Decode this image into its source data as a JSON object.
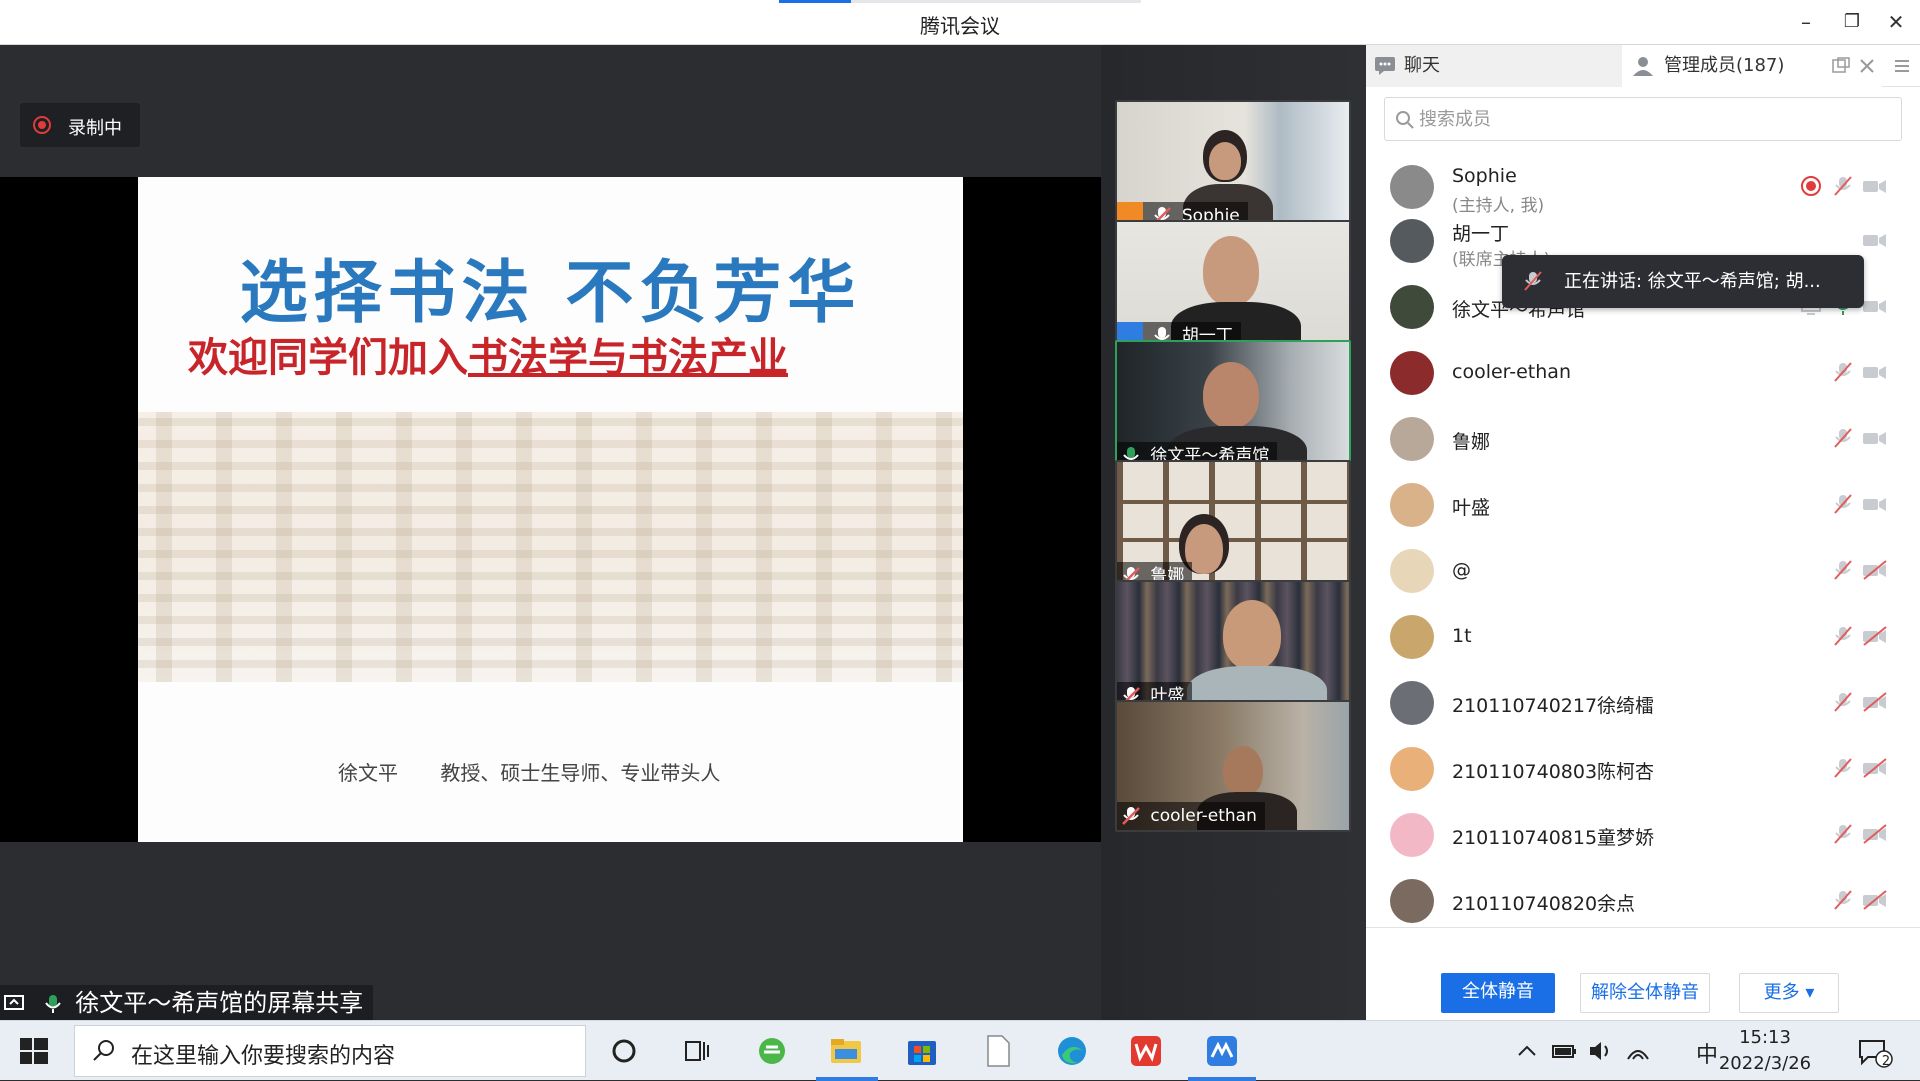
{
  "window": {
    "title": "腾讯会议",
    "minimize_label": "–",
    "restore_label": "❐",
    "close_label": "✕"
  },
  "recording": {
    "label": "录制中"
  },
  "slide": {
    "title": "选择书法  不负芳华",
    "subtitle_prefix": "欢迎同学们加入",
    "subtitle_underlined": "书法学与书法产业",
    "author": "徐文平",
    "author_titles": "教授、硕士生导师、专业带头人"
  },
  "share_label": "徐文平～希声馆的屏幕共享",
  "video_tiles": [
    {
      "name": "Sophie",
      "role": "host",
      "mic": "muted"
    },
    {
      "name": "胡一丁",
      "role": "cohost",
      "mic": "on"
    },
    {
      "name": "徐文平～希声馆",
      "role": "",
      "mic": "speaking",
      "active": true
    },
    {
      "name": "鲁娜",
      "role": "",
      "mic": "muted"
    },
    {
      "name": "叶盛",
      "role": "",
      "mic": "muted"
    },
    {
      "name": "cooler-ethan",
      "role": "",
      "mic": "muted"
    }
  ],
  "panel": {
    "tab_chat": "聊天",
    "tab_members": "管理成员(187)",
    "search_placeholder": "搜索成员",
    "speaking_tooltip": "正在讲话: 徐文平～希声馆; 胡...",
    "members": [
      {
        "name": "Sophie",
        "role": "(主持人, 我)",
        "recording": true,
        "mic": "muted",
        "video": "off",
        "avatar_color": "#8a8a8a"
      },
      {
        "name": "胡一丁",
        "role": "(联席主持人)",
        "mic": "on",
        "video": "off",
        "avatar_color": "#555a5f"
      },
      {
        "name": "徐文平～希声馆",
        "role": "",
        "screen_share": true,
        "mic": "speaking",
        "video": "off",
        "avatar_color": "#3f4a3a"
      },
      {
        "name": "cooler-ethan",
        "role": "",
        "mic": "muted",
        "video": "off",
        "avatar_color": "#8b2b2b"
      },
      {
        "name": "鲁娜",
        "role": "",
        "mic": "muted",
        "video": "off",
        "avatar_color": "#b8a89a"
      },
      {
        "name": "叶盛",
        "role": "",
        "mic": "muted",
        "video": "off",
        "avatar_color": "#d9b28a"
      },
      {
        "name": "@",
        "role": "",
        "mic": "muted",
        "video": "muted",
        "avatar_color": "#e8d6b8"
      },
      {
        "name": "1t",
        "role": "",
        "mic": "muted",
        "video": "muted",
        "avatar_color": "#c9a66b"
      },
      {
        "name": "210110740217徐绮檑",
        "role": "",
        "mic": "muted",
        "video": "muted",
        "avatar_color": "#6b6f75"
      },
      {
        "name": "210110740803陈柯杏",
        "role": "",
        "mic": "muted",
        "video": "muted",
        "avatar_color": "#e9b07a"
      },
      {
        "name": "210110740815童梦娇",
        "role": "",
        "mic": "muted",
        "video": "muted",
        "avatar_color": "#f2b8c6"
      },
      {
        "name": "210110740820余点",
        "role": "",
        "mic": "muted",
        "video": "muted",
        "avatar_color": "#7a6a60"
      }
    ],
    "btn_mute_all": "全体静音",
    "btn_unmute_all": "解除全体静音",
    "btn_more": "更多 ▾"
  },
  "taskbar": {
    "search_text": "在这里输入你要搜索的内容",
    "input_lang": "中",
    "time": "15:13",
    "date": "2022/3/26",
    "notification_count": "2"
  },
  "colors": {
    "accent": "#1a6fe6",
    "record_red": "#e23b3b",
    "speaking_green": "#2fa05a",
    "muted_red": "#e25c5c"
  }
}
